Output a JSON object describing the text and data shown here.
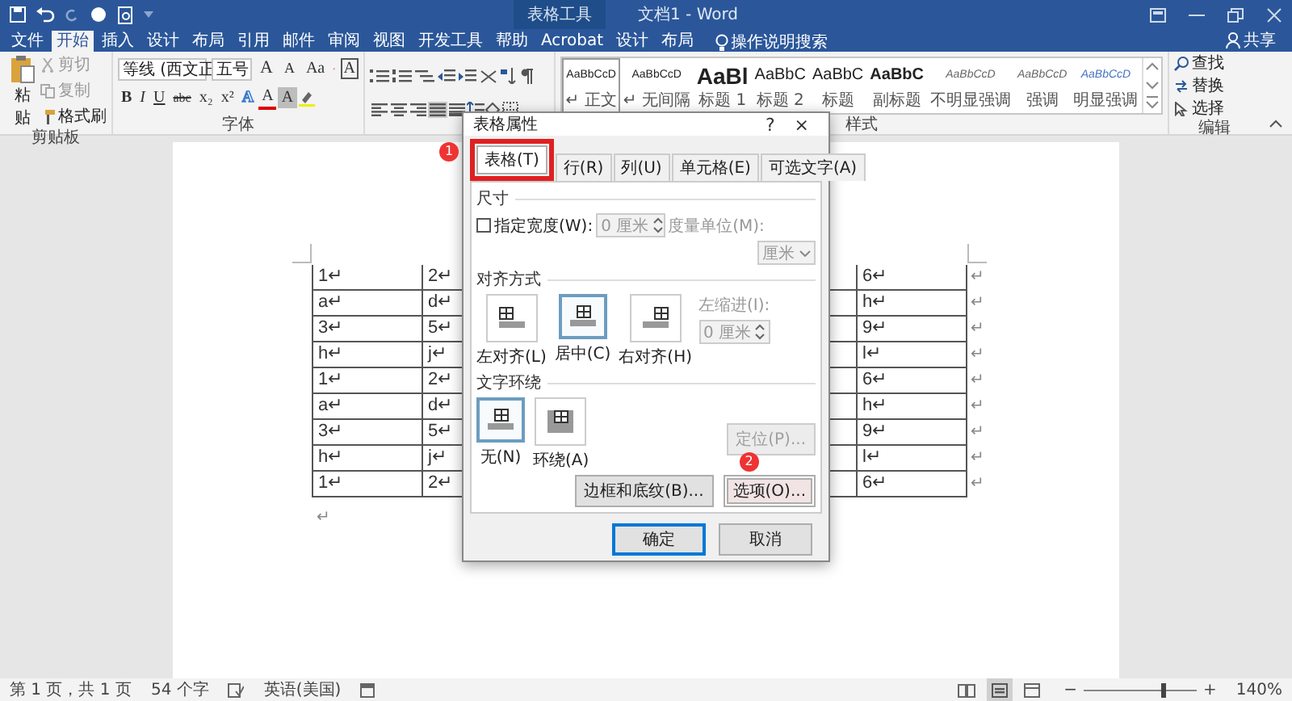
{
  "title_bar": {
    "context_label": "表格工具",
    "title": "文档1 - Word"
  },
  "ribbon_tabs": [
    {
      "label": "文件",
      "selected": false
    },
    {
      "label": "开始",
      "selected": true
    },
    {
      "label": "插入",
      "selected": false
    },
    {
      "label": "设计",
      "selected": false
    },
    {
      "label": "布局",
      "selected": false
    },
    {
      "label": "引用",
      "selected": false
    },
    {
      "label": "邮件",
      "selected": false
    },
    {
      "label": "审阅",
      "selected": false
    },
    {
      "label": "视图",
      "selected": false
    },
    {
      "label": "开发工具",
      "selected": false
    },
    {
      "label": "帮助",
      "selected": false
    },
    {
      "label": "Acrobat",
      "selected": false
    },
    {
      "label": "设计",
      "selected": false
    },
    {
      "label": "布局",
      "selected": false
    }
  ],
  "search": {
    "placeholder": "操作说明搜索"
  },
  "share": "共享",
  "clipboard": {
    "paste": "粘贴",
    "items": [
      {
        "label": "剪切",
        "kind": "cut",
        "disabled": true
      },
      {
        "label": "复制",
        "kind": "copy",
        "disabled": true
      },
      {
        "label": "格式刷",
        "kind": "painter",
        "disabled": false
      }
    ],
    "group": "剪贴板"
  },
  "font": {
    "name": "等线 (西文正",
    "size": "五号",
    "row1": [
      {
        "text": "A",
        "kind": "grow"
      },
      {
        "text": "A",
        "kind": "shrink"
      },
      {
        "text": "Aa",
        "kind": "case"
      }
    ],
    "boxed": "A",
    "row2": [
      {
        "text": "B",
        "kind": "bold"
      },
      {
        "text": "I",
        "kind": "italic"
      },
      {
        "text": "U",
        "kind": "underline"
      },
      {
        "text": "abc",
        "kind": "strike"
      },
      {
        "text": "x₂",
        "kind": "plain"
      },
      {
        "text": "x²",
        "kind": "plain"
      }
    ],
    "row2b": [
      {
        "text": "A",
        "kind": "effect"
      },
      {
        "text": "A",
        "kind": "fontcolor"
      },
      {
        "text": "A",
        "kind": "shading"
      }
    ],
    "group": "字体"
  },
  "paragraph": {
    "alignment": [
      {
        "kind": "left",
        "selected": false
      },
      {
        "kind": "center",
        "selected": false
      },
      {
        "kind": "right",
        "selected": false
      },
      {
        "kind": "justify",
        "selected": true
      },
      {
        "kind": "distributed",
        "selected": false
      }
    ]
  },
  "styles": {
    "items": [
      {
        "preview": "AaBbCcD",
        "name": "↵ 正文",
        "kind": "normal",
        "selected": true
      },
      {
        "preview": "AaBbCcD",
        "name": "↵ 无间隔",
        "kind": "normal",
        "selected": false
      },
      {
        "preview": "AaBl",
        "name": "标题 1",
        "kind": "heading1",
        "selected": false
      },
      {
        "preview": "AaBbC",
        "name": "标题 2",
        "kind": "heading2",
        "selected": false
      },
      {
        "preview": "AaBbC",
        "name": "标题",
        "kind": "heading2",
        "selected": false
      },
      {
        "preview": "AaBbC",
        "name": "副标题",
        "kind": "subtitle",
        "selected": false
      },
      {
        "preview": "AaBbCcD",
        "name": "不明显强调",
        "kind": "emphasis",
        "selected": false
      },
      {
        "preview": "AaBbCcD",
        "name": "强调",
        "kind": "emphasis",
        "selected": false
      },
      {
        "preview": "AaBbCcD",
        "name": "明显强调",
        "kind": "intense",
        "selected": false
      }
    ],
    "group": "样式"
  },
  "editing": {
    "items": [
      {
        "label": "查找",
        "kind": "find"
      },
      {
        "label": "替换",
        "kind": "replace"
      },
      {
        "label": "选择",
        "kind": "select"
      }
    ],
    "group": "编辑"
  },
  "document": {
    "rows": [
      {
        "cells": [
          "1↵",
          "2↵",
          "6↵"
        ],
        "end_mark": "↵"
      },
      {
        "cells": [
          "a↵",
          "d↵",
          "h↵"
        ],
        "end_mark": "↵"
      },
      {
        "cells": [
          "3↵",
          "5↵",
          "9↵"
        ],
        "end_mark": "↵"
      },
      {
        "cells": [
          "h↵",
          "j↵",
          "l↵"
        ],
        "end_mark": "↵"
      },
      {
        "cells": [
          "1↵",
          "2↵",
          "6↵"
        ],
        "end_mark": "↵"
      },
      {
        "cells": [
          "a↵",
          "d↵",
          "h↵"
        ],
        "end_mark": "↵"
      },
      {
        "cells": [
          "3↵",
          "5↵",
          "9↵"
        ],
        "end_mark": "↵"
      },
      {
        "cells": [
          "h↵",
          "j↵",
          "l↵"
        ],
        "end_mark": "↵"
      },
      {
        "cells": [
          "1↵",
          "2↵",
          "6↵"
        ],
        "end_mark": "↵"
      }
    ],
    "after_mark": "↵"
  },
  "dialog": {
    "title": "表格属性",
    "help": "?",
    "close": "×",
    "tabs": [
      {
        "label": "表格(T)",
        "selected": true,
        "highlighted": true,
        "marker": "1"
      },
      {
        "label": "行(R)",
        "selected": false,
        "highlighted": false
      },
      {
        "label": "列(U)",
        "selected": false,
        "highlighted": false
      },
      {
        "label": "单元格(E)",
        "selected": false,
        "highlighted": false
      },
      {
        "label": "可选文字(A)",
        "selected": false,
        "highlighted": false
      }
    ],
    "size": {
      "heading": "尺寸",
      "checkbox": {
        "label": "指定宽度(W):",
        "checked": false
      },
      "width": {
        "value": "0 厘米",
        "disabled": true
      },
      "unit_label": "度量单位(M):",
      "unit": {
        "value": "厘米",
        "disabled": true
      }
    },
    "alignment": {
      "heading": "对齐方式",
      "options": [
        {
          "label": "左对齐(L)",
          "kind": "left",
          "selected": false
        },
        {
          "label": "居中(C)",
          "kind": "center",
          "selected": true
        },
        {
          "label": "右对齐(H)",
          "kind": "right",
          "selected": false
        }
      ],
      "indent_label": "左缩进(I):",
      "indent": {
        "value": "0 厘米",
        "disabled": true
      }
    },
    "wrapping": {
      "heading": "文字环绕",
      "options": [
        {
          "label": "无(N)",
          "kind": "none",
          "selected": true
        },
        {
          "label": "环绕(A)",
          "kind": "around",
          "selected": false
        }
      ],
      "position_button": {
        "label": "定位(P)...",
        "disabled": true
      }
    },
    "buttons": [
      {
        "label": "边框和底纹(B)...",
        "highlighted": false
      },
      {
        "label": "选项(O)...",
        "highlighted": true,
        "marker": "2"
      }
    ],
    "footer": [
      {
        "label": "确定",
        "default": true
      },
      {
        "label": "取消",
        "default": false
      }
    ]
  },
  "status_bar": {
    "page": "第 1 页，共 1 页",
    "words": "54 个字",
    "language": "英语(美国)",
    "views": [
      {
        "kind": "read",
        "selected": false
      },
      {
        "kind": "print",
        "selected": true
      },
      {
        "kind": "web",
        "selected": false
      }
    ],
    "zoom_out": "−",
    "zoom_in": "+",
    "zoom": {
      "level": 0.7
    },
    "zoom_value": "140%"
  }
}
